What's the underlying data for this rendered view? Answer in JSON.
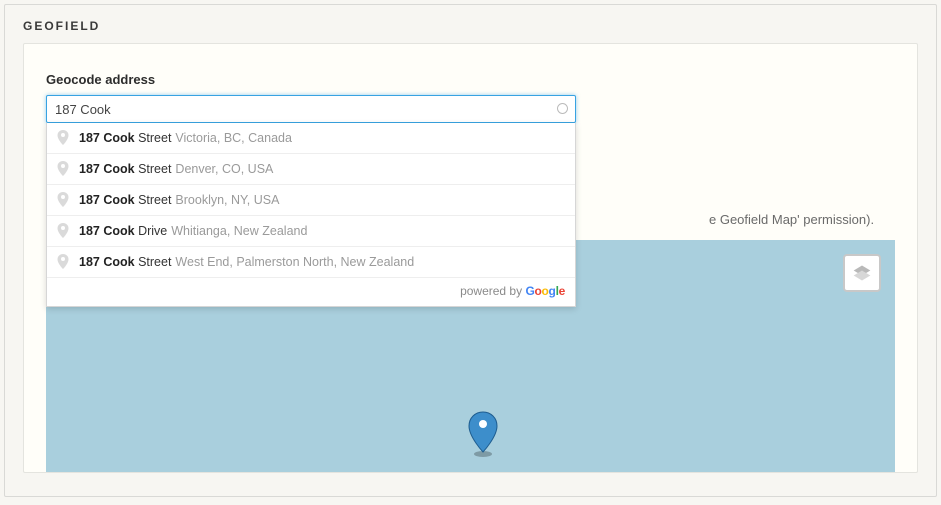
{
  "legend": "GEOFIELD",
  "field": {
    "label": "Geocode address",
    "value": "187 Cook ",
    "placeholder": ""
  },
  "hint_tail": "e Geofield Map' permission).",
  "suggestions": [
    {
      "match": "187 Cook",
      "main_rest": " Street",
      "secondary": "Victoria, BC, Canada"
    },
    {
      "match": "187 Cook",
      "main_rest": " Street",
      "secondary": "Denver, CO, USA"
    },
    {
      "match": "187 Cook",
      "main_rest": " Street",
      "secondary": "Brooklyn, NY, USA"
    },
    {
      "match": "187 Cook",
      "main_rest": " Drive",
      "secondary": "Whitianga, New Zealand"
    },
    {
      "match": "187 Cook",
      "main_rest": " Street",
      "secondary": "West End, Palmerston North, New Zealand"
    }
  ],
  "attribution": {
    "prefix": "powered by ",
    "brand": "Google"
  },
  "icons": {
    "spinner": "loading-spinner",
    "layers": "layers-icon",
    "marker": "map-pin-icon",
    "suggestion_pin": "location-pin-icon"
  },
  "colors": {
    "map_bg": "#a9cfdd",
    "focus": "#38a3e2",
    "marker": "#2b7cc1"
  }
}
